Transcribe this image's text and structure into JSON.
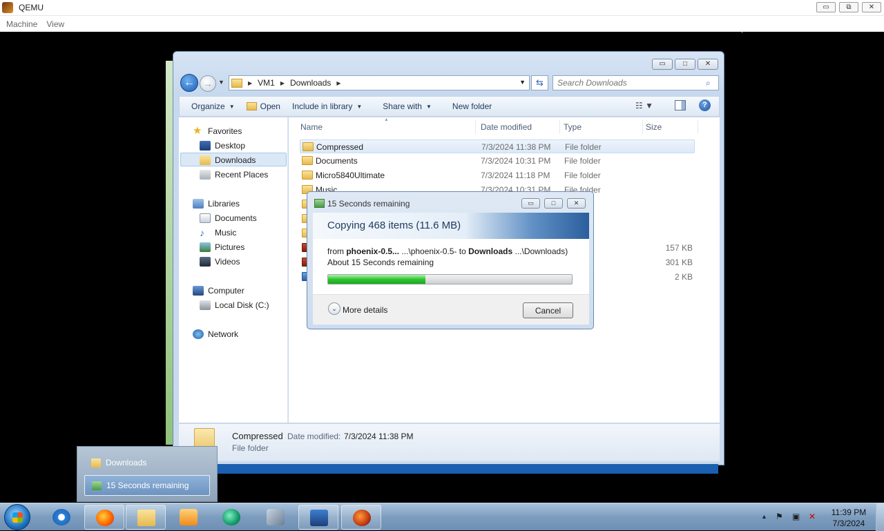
{
  "host": {
    "title": "QEMU",
    "menus": [
      "Machine",
      "View"
    ],
    "controls": {
      "minimize": "▭",
      "restore": "⧉",
      "close": "✕"
    }
  },
  "address": {
    "crumbs": [
      "VM1",
      "Downloads"
    ],
    "search_placeholder": "Search Downloads"
  },
  "toolbar": {
    "organize": "Organize",
    "open": "Open",
    "include_in_library": "Include in library",
    "share_with": "Share with",
    "new_folder": "New folder"
  },
  "nav": {
    "favorites": "Favorites",
    "desktop": "Desktop",
    "downloads": "Downloads",
    "recent_places": "Recent Places",
    "libraries": "Libraries",
    "documents": "Documents",
    "music": "Music",
    "pictures": "Pictures",
    "videos": "Videos",
    "computer": "Computer",
    "local_disk": "Local Disk (C:)",
    "network": "Network"
  },
  "columns": {
    "name": "Name",
    "date": "Date modified",
    "type": "Type",
    "size": "Size"
  },
  "files": [
    {
      "name": "Compressed",
      "date": "7/3/2024 11:38 PM",
      "type": "File folder",
      "size": ""
    },
    {
      "name": "Documents",
      "date": "7/3/2024 10:31 PM",
      "type": "File folder",
      "size": ""
    },
    {
      "name": "Micro5840Ultimate",
      "date": "7/3/2024 11:18 PM",
      "type": "File folder",
      "size": ""
    },
    {
      "name": "Music",
      "date": "7/3/2024 10:31 PM",
      "type": "File folder",
      "size": ""
    },
    {
      "name": "",
      "date": "",
      "type": "er",
      "size": ""
    },
    {
      "name": "",
      "date": "",
      "type": "er",
      "size": ""
    },
    {
      "name": "",
      "date": "",
      "type": "er",
      "size": ""
    },
    {
      "name": "",
      "date": "",
      "type": "age",
      "size": "157 KB"
    },
    {
      "name": "",
      "date": "",
      "type": "age",
      "size": "301 KB"
    },
    {
      "name": "",
      "date": "",
      "type": "",
      "size": "2 KB"
    }
  ],
  "details": {
    "name": "Compressed",
    "date_label": "Date modified:",
    "date": "7/3/2024 11:38 PM",
    "type": "File folder"
  },
  "copy_dialog": {
    "title": "15 Seconds remaining",
    "header": "Copying 468 items (11.6 MB)",
    "from_word": "from",
    "from_name": "phoenix-0.5...",
    "from_path": "...\\phoenix-0.5-",
    "to_word": "to",
    "to_name": "Downloads",
    "to_path": "...\\Downloads)",
    "about": "About 15 Seconds remaining",
    "progress_percent": 40,
    "more_details": "More details",
    "cancel": "Cancel"
  },
  "task_popup": {
    "items": [
      "Downloads",
      "15 Seconds remaining"
    ]
  },
  "clock": {
    "time": "11:39 PM",
    "date": "7/3/2024"
  },
  "colors": {
    "accent": "#1b5fb7",
    "progress": "#2bc72e"
  }
}
